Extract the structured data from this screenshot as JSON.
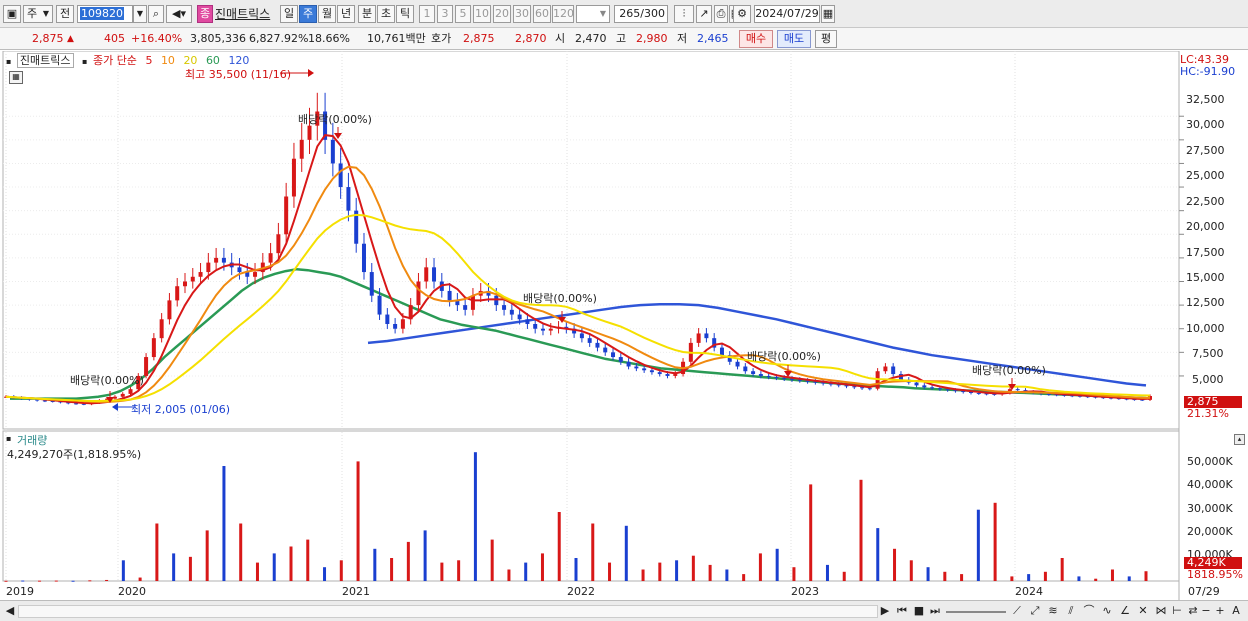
{
  "toolbar": {
    "market_label": "주",
    "prev_label": "전",
    "stock_code": "109820",
    "stock_name": "진매트릭스",
    "stock_badge": "종",
    "period_buttons": [
      "일",
      "주",
      "월",
      "년",
      "분",
      "초",
      "틱"
    ],
    "period_selected": "주",
    "interval_buttons": [
      "1",
      "3",
      "5",
      "10",
      "20",
      "30",
      "60",
      "120"
    ],
    "count_value": "265",
    "count_total": "/300",
    "date_value": "2024/07/29"
  },
  "quote": {
    "price": "2,875",
    "change": "405",
    "change_pct": "+16.40%",
    "volume": "3,805,336",
    "volume_pct": "6,827.92%",
    "turnover": "18.66%",
    "amount": "10,761백만",
    "bid_label": "호가",
    "ask": "2,875",
    "bid": "2,870",
    "open_label": "시",
    "open": "2,470",
    "high_label": "고",
    "high": "2,980",
    "low_label": "저",
    "low": "2,465",
    "buy_label": "매수",
    "sell_label": "매도",
    "eval_label": "평"
  },
  "legend": {
    "name": "진매트릭스",
    "ma_label": "종가 단순",
    "ma_periods": [
      "5",
      "10",
      "20",
      "60",
      "120"
    ],
    "ma_colors": [
      "#d81818",
      "#f08a10",
      "#f5e000",
      "#2a9a55",
      "#2f55d8"
    ]
  },
  "annotations": {
    "max_label": "최고 35,500 (11/16)",
    "min_label": "최저 2,005 (01/06)",
    "dividend_labels": [
      "배당락(0.00%)",
      "배당락(0.00%)",
      "배당락(0.00%)",
      "배당락(0.00%)",
      "배당락(0.00%)"
    ]
  },
  "price_axis": {
    "ticks": [
      "32,500",
      "30,000",
      "27,500",
      "25,000",
      "22,500",
      "20,000",
      "17,500",
      "15,000",
      "12,500",
      "10,000",
      "7,500",
      "5,000"
    ],
    "lc_label": "LC:43.39",
    "hc_label": "HC:-91.90",
    "current_label": "2,875",
    "pct_label": "21.31%"
  },
  "volume_panel": {
    "title": "거래량",
    "value_label": "4,249,270주(1,818.95%)",
    "ticks": [
      "50,000K",
      "40,000K",
      "30,000K",
      "20,000K",
      "10,000K"
    ],
    "current_label": "4,249K",
    "pct_label": "1818.95%"
  },
  "time_axis": {
    "labels": [
      "2019",
      "2020",
      "2021",
      "2022",
      "2023",
      "2024",
      "07/29"
    ]
  },
  "chart_data": {
    "type": "candlestick",
    "period": "weekly",
    "ylim": [
      1500,
      37500
    ],
    "x_years": [
      "2019",
      "2020",
      "2021",
      "2022",
      "2023",
      "2024"
    ],
    "close_series": [
      2800,
      2700,
      2600,
      2500,
      2400,
      2350,
      2300,
      2200,
      2100,
      2050,
      2005,
      2150,
      2400,
      2600,
      2800,
      3100,
      3600,
      5000,
      7000,
      9000,
      11000,
      13000,
      14500,
      15000,
      15500,
      16000,
      17000,
      17500,
      17000,
      16500,
      16000,
      15500,
      16000,
      17000,
      18000,
      20000,
      24000,
      28000,
      30000,
      31500,
      33000,
      30000,
      27500,
      25000,
      22500,
      19000,
      16000,
      13500,
      11500,
      10500,
      10000,
      11000,
      12500,
      15000,
      16500,
      15000,
      14000,
      13000,
      12500,
      12000,
      13500,
      14000,
      13500,
      12500,
      12000,
      11500,
      11000,
      10500,
      10000,
      9800,
      10000,
      10200,
      10000,
      9500,
      9000,
      8500,
      8000,
      7500,
      7000,
      6500,
      6000,
      5800,
      5600,
      5400,
      5200,
      5000,
      5200,
      6500,
      8500,
      9500,
      9000,
      8000,
      7200,
      6500,
      6000,
      5500,
      5200,
      5000,
      4900,
      4800,
      4700,
      4600,
      4500,
      4400,
      4300,
      4200,
      4100,
      4000,
      3900,
      3800,
      3700,
      3650,
      5500,
      6000,
      5200,
      4600,
      4300,
      4000,
      3800,
      3700,
      3600,
      3500,
      3400,
      3300,
      3200,
      3150,
      3100,
      3050,
      3200,
      3600,
      3500,
      3300,
      3200,
      3100,
      3050,
      3000,
      2950,
      2900,
      2850,
      2800,
      2750,
      2700,
      2650,
      2600,
      2550,
      2500,
      2470,
      2875
    ],
    "ma60_series": [
      2600,
      2600,
      2600,
      2600,
      2600,
      2600,
      2600,
      2700,
      2800,
      3000,
      3400,
      4000,
      4800,
      5800,
      7000,
      8000,
      9000,
      10000,
      11000,
      12000,
      13000,
      14000,
      14800,
      15400,
      15800,
      16100,
      16300,
      16200,
      16000,
      15800,
      15500,
      15000,
      14500,
      14000,
      13500,
      13000,
      12500,
      12000,
      11500,
      11000,
      10700,
      10400,
      10200,
      10000,
      9800,
      9500,
      9200,
      8900,
      8600,
      8300,
      8000,
      7700,
      7400,
      7100,
      6800,
      6600,
      6400,
      6200,
      6000,
      5800,
      5700,
      5600,
      5500,
      5400,
      5300,
      5200,
      5100,
      5000,
      4900,
      4800,
      4700,
      4600,
      4500,
      4400,
      4300,
      4200,
      4100,
      4000,
      3950,
      3900,
      3850,
      3800,
      3700,
      3650,
      3600,
      3550,
      3500,
      3450,
      3400,
      3350,
      3300,
      3250,
      3200,
      3150,
      3100,
      3050,
      3000,
      2950,
      2900,
      2850,
      2800,
      2750,
      2700,
      2650
    ],
    "ma120_series": [
      8500,
      8700,
      9000,
      9300,
      9600,
      9900,
      10200,
      10500,
      10800,
      11100,
      11400,
      11700,
      12000,
      12300,
      12500,
      12600,
      12600,
      12500,
      12200,
      11800,
      11400,
      11000,
      10500,
      10000,
      9500,
      9000,
      8500,
      8000,
      7600,
      7200,
      6900,
      6600,
      6300,
      6000,
      5700,
      5400,
      5100,
      4800,
      4500,
      4200,
      4000
    ],
    "volume_k": [
      100,
      200,
      150,
      180,
      120,
      300,
      450,
      9000,
      1500,
      25000,
      12000,
      10500,
      22000,
      50000,
      25000,
      8000,
      12000,
      15000,
      18000,
      6000,
      9000,
      52000,
      14000,
      10000,
      17000,
      22000,
      8000,
      9000,
      56000,
      18000,
      5000,
      8000,
      12000,
      30000,
      10000,
      25000,
      8000,
      24000,
      5000,
      8000,
      9000,
      11000,
      7000,
      5000,
      3000,
      12000,
      14000,
      6000,
      42000,
      7000,
      4000,
      44000,
      23000,
      14000,
      9000,
      6000,
      4000,
      3000,
      31000,
      34000,
      2000,
      3000,
      4000,
      10000,
      2000,
      1000,
      5000,
      2000,
      4249
    ]
  }
}
